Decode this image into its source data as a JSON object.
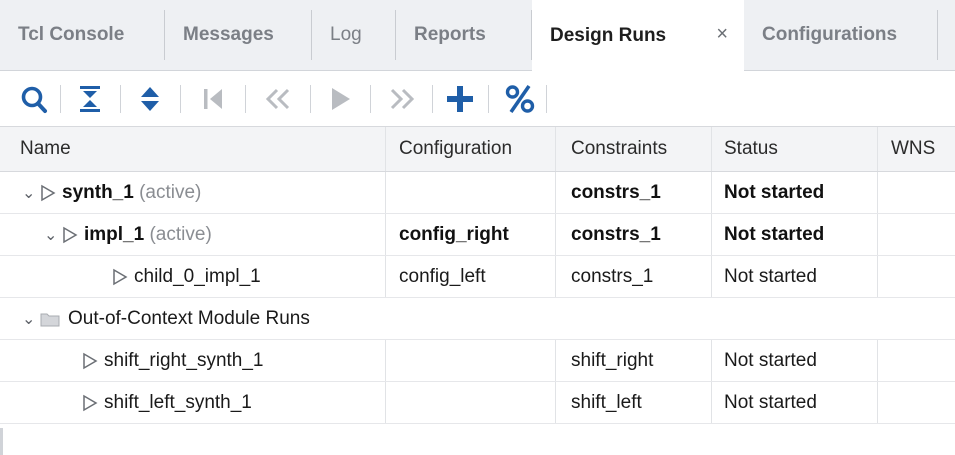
{
  "tabs": [
    {
      "label": "Tcl Console"
    },
    {
      "label": "Messages"
    },
    {
      "label": "Log"
    },
    {
      "label": "Reports"
    },
    {
      "label": "Design Runs",
      "close": "×"
    },
    {
      "label": "Configurations"
    }
  ],
  "toolbar": {
    "icons": [
      "search-icon",
      "collapse-all-icon",
      "expand-icon",
      "first-icon",
      "previous-icon",
      "run-icon",
      "next-icon",
      "add-icon",
      "percent-icon"
    ]
  },
  "columns": {
    "name": "Name",
    "configuration": "Configuration",
    "constraints": "Constraints",
    "status": "Status",
    "wns": "WNS"
  },
  "rows": [
    {
      "name": "synth_1",
      "suffix": "(active)",
      "configuration": "",
      "constraints": "constrs_1",
      "status": "Not started"
    },
    {
      "name": "impl_1",
      "suffix": "(active)",
      "configuration": "config_right",
      "constraints": "constrs_1",
      "status": "Not started"
    },
    {
      "name": "child_0_impl_1",
      "configuration": "config_left",
      "constraints": "constrs_1",
      "status": "Not started"
    },
    {
      "name": "Out-of-Context Module Runs"
    },
    {
      "name": "shift_right_synth_1",
      "configuration": "",
      "constraints": "shift_right",
      "status": "Not started"
    },
    {
      "name": "shift_left_synth_1",
      "configuration": "",
      "constraints": "shift_left",
      "status": "Not started"
    }
  ],
  "colors": {
    "accent": "#1f5ea8",
    "run_green": "#2e9a3a"
  }
}
